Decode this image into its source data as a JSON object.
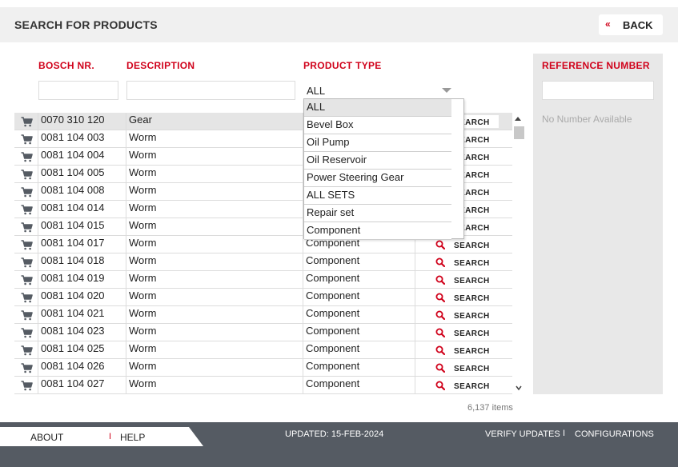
{
  "header": {
    "title": "SEARCH FOR PRODUCTS",
    "back_chevron": "«",
    "back_label": "BACK"
  },
  "filters": {
    "bosch_nr_label": "BOSCH NR.",
    "description_label": "DESCRIPTION",
    "product_type_label": "PRODUCT TYPE",
    "bosch_nr_value": "",
    "description_value": "",
    "product_type_selected": "ALL"
  },
  "dropdown": {
    "options": [
      "ALL",
      "Bevel Box",
      "Oil Pump",
      "Oil Reservoir",
      "Power Steering Gear",
      "ALL SETS",
      "Repair set",
      "Component"
    ]
  },
  "table": {
    "search_label": "SEARCH",
    "rows": [
      {
        "nr": "0070 310 120",
        "desc": "Gear",
        "type": "",
        "selected": true
      },
      {
        "nr": "0081 104 003",
        "desc": "Worm",
        "type": ""
      },
      {
        "nr": "0081 104 004",
        "desc": "Worm",
        "type": ""
      },
      {
        "nr": "0081 104 005",
        "desc": "Worm",
        "type": ""
      },
      {
        "nr": "0081 104 008",
        "desc": "Worm",
        "type": ""
      },
      {
        "nr": "0081 104 014",
        "desc": "Worm",
        "type": ""
      },
      {
        "nr": "0081 104 015",
        "desc": "Worm",
        "type": ""
      },
      {
        "nr": "0081 104 017",
        "desc": "Worm",
        "type": "Component"
      },
      {
        "nr": "0081 104 018",
        "desc": "Worm",
        "type": "Component"
      },
      {
        "nr": "0081 104 019",
        "desc": "Worm",
        "type": "Component"
      },
      {
        "nr": "0081 104 020",
        "desc": "Worm",
        "type": "Component"
      },
      {
        "nr": "0081 104 021",
        "desc": "Worm",
        "type": "Component"
      },
      {
        "nr": "0081 104 023",
        "desc": "Worm",
        "type": "Component"
      },
      {
        "nr": "0081 104 025",
        "desc": "Worm",
        "type": "Component"
      },
      {
        "nr": "0081 104 026",
        "desc": "Worm",
        "type": "Component"
      },
      {
        "nr": "0081 104 027",
        "desc": "Worm",
        "type": "Component"
      }
    ],
    "items_count": "6,137 items"
  },
  "reference": {
    "label": "REFERENCE NUMBER",
    "value": "",
    "empty_text": "No Number Available"
  },
  "footer": {
    "about": "ABOUT",
    "separator": "I",
    "help": "HELP",
    "updated": "UPDATED: 15-FEB-2024",
    "verify": "VERIFY UPDATES",
    "config": "CONFIGURATIONS"
  },
  "icons": {
    "row_icon": "cart-icon",
    "search_icon": "magnifier-icon"
  },
  "colors": {
    "accent": "#d0021b",
    "footer": "#555b63",
    "selected_row": "#e5e5e5",
    "header_bg": "#f0f0f0"
  }
}
